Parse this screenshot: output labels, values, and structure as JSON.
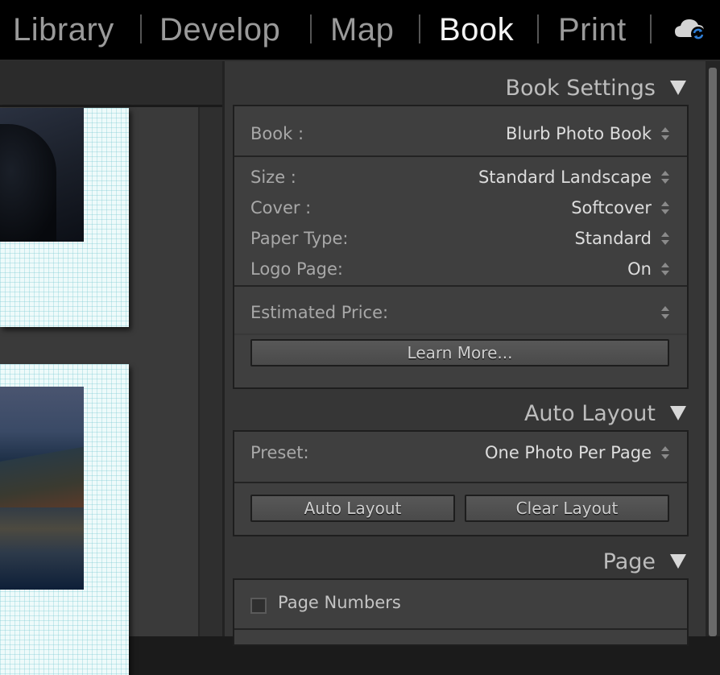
{
  "topbar": {
    "modules": [
      "Library",
      "Develop",
      "Map",
      "Book",
      "Print"
    ],
    "active": "Book",
    "sync_icon": "cloud-sync-icon",
    "colors": {
      "active": "#f4f4f4",
      "inactive": "#9a9a9a",
      "sync_accent": "#2f7fd8"
    }
  },
  "book_settings": {
    "title": "Book Settings",
    "book_label": "Book :",
    "book_value": "Blurb Photo Book",
    "size_label": "Size :",
    "size_value": "Standard Landscape",
    "cover_label": "Cover :",
    "cover_value": "Softcover",
    "paper_label": "Paper Type:",
    "paper_value": "Standard",
    "logo_label": "Logo Page:",
    "logo_value": "On",
    "price_label": "Estimated Price:",
    "price_value": "",
    "learn_more": "Learn More..."
  },
  "auto_layout": {
    "title": "Auto Layout",
    "preset_label": "Preset:",
    "preset_value": "One Photo Per Page",
    "auto_layout_button": "Auto Layout",
    "clear_layout_button": "Clear Layout"
  },
  "page": {
    "title": "Page",
    "page_numbers_label": "Page Numbers",
    "page_numbers_checked": false
  }
}
